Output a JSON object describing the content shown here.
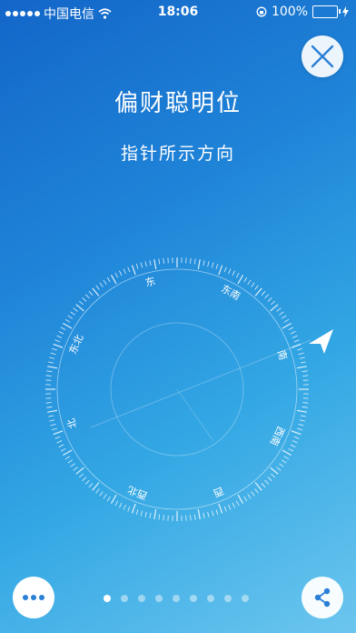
{
  "status_bar": {
    "carrier": "中国电信",
    "time": "18:06",
    "battery": "100%"
  },
  "header": {
    "title": "偏财聪明位",
    "subtitle": "指针所示方向"
  },
  "compass": {
    "labels": [
      "东",
      "东南",
      "南",
      "西南",
      "西",
      "西北",
      "北",
      "东北"
    ]
  },
  "pager": {
    "count": 9,
    "active_index": 0
  },
  "icons": {
    "close": "close-icon",
    "more": "more-icon",
    "share": "share-icon",
    "pointer": "arrow-pointer-icon"
  },
  "colors": {
    "accent": "#2a7fd6",
    "background_top": "#1366c8",
    "background_bottom": "#6cc6ee"
  }
}
